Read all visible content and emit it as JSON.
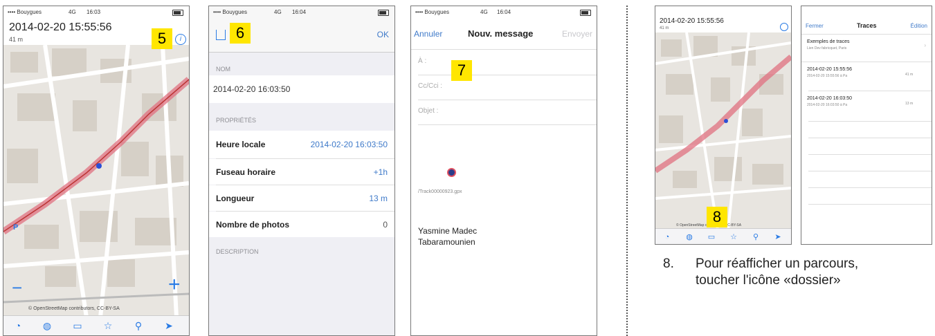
{
  "colors": {
    "callout": "#ffe600",
    "accent": "#3f7ac9",
    "track": "#e06070"
  },
  "phone1": {
    "carrier": "•••• Bouygues",
    "network": "4G",
    "time": "16:03",
    "title": "2014-02-20 15:55:56",
    "subtitle": "41 m",
    "callout": "5",
    "map_attribution": "© OpenStreetMap contributors, CC-BY-SA",
    "zoom_in": "+",
    "zoom_out": "−",
    "parking_label": "P",
    "tabs": [
      "speedometer-icon",
      "globe-icon",
      "folder-icon",
      "star-icon",
      "search-icon",
      "location-icon"
    ]
  },
  "phone2": {
    "carrier": "•••• Bouygues",
    "network": "4G",
    "time": "16:04",
    "callout": "6",
    "ok": "OK",
    "section_name": "NOM",
    "name_value": "2014-02-20 16:03:50",
    "section_props": "PROPRIÉTÉS",
    "rows": [
      {
        "label": "Heure locale",
        "value": "2014-02-20 16:03:50"
      },
      {
        "label": "Fuseau horaire",
        "value": "+1h"
      },
      {
        "label": "Longueur",
        "value": "13 m"
      },
      {
        "label": "Nombre de photos",
        "value": "0"
      }
    ],
    "section_desc": "DESCRIPTION"
  },
  "phone3": {
    "carrier": "•••• Bouygues",
    "network": "4G",
    "time": "16:04",
    "cancel": "Annuler",
    "title": "Nouv. message",
    "send": "Envoyer",
    "to": "À :",
    "cc": "Cc/Cci :",
    "subject": "Objet :",
    "callout": "7",
    "attachment": "/Track00000923.gpx",
    "signature_line1": "Yasmine Madec",
    "signature_line2": "Tabaramounien"
  },
  "phone4": {
    "title": "2014-02-20 15:55:56",
    "subtitle": "41 m",
    "callout": "8",
    "map_attribution": "© OpenStreetMap contributors, CC-BY-SA"
  },
  "phone5": {
    "close": "Fermer",
    "title": "Traces",
    "edit": "Édition",
    "items": [
      {
        "title": "Exemples de traces",
        "sub": "Lien Dev fabricquet, Paris",
        "right": ""
      },
      {
        "title": "2014-02-20 15:55:56",
        "sub": "2014-02-20 15:55:56 à Pa",
        "right": "41 m"
      },
      {
        "title": "2014-02-20 16:03:50",
        "sub": "2014-02-20 16:03:50 à Pa",
        "right": "13 m"
      }
    ]
  },
  "caption": {
    "number": "8.",
    "line1": "Pour réafficher un parcours,",
    "line2": "toucher l'icône «dossier»"
  }
}
